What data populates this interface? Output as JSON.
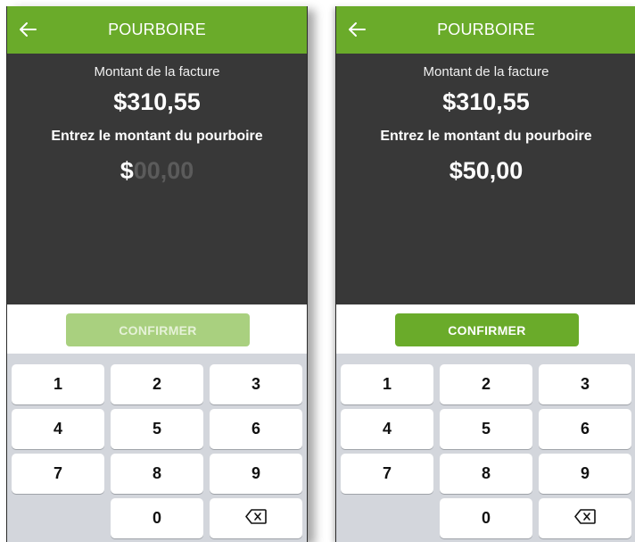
{
  "screens": [
    {
      "title": "POURBOIRE",
      "bill_label": "Montant de la facture",
      "bill_amount": "$310,55",
      "tip_label": "Entrez le montant du pourboire",
      "tip_prefix": "$",
      "tip_value": "",
      "tip_placeholder": "00,00",
      "confirm_label": "CONFIRMER",
      "confirm_state": "disabled"
    },
    {
      "title": "POURBOIRE",
      "bill_label": "Montant de la facture",
      "bill_amount": "$310,55",
      "tip_label": "Entrez le montant du pourboire",
      "tip_prefix": "$",
      "tip_value": "50,00",
      "tip_placeholder": "",
      "confirm_label": "CONFIRMER",
      "confirm_state": "enabled"
    }
  ],
  "keypad": {
    "k1": "1",
    "k2": "2",
    "k3": "3",
    "k4": "4",
    "k5": "5",
    "k6": "6",
    "k7": "7",
    "k8": "8",
    "k9": "9",
    "k0": "0",
    "backspace_icon": "backspace-icon"
  },
  "colors": {
    "brand_green": "#6aab2a",
    "dark_panel": "#383838",
    "keypad_bg": "#d3d6dc"
  }
}
